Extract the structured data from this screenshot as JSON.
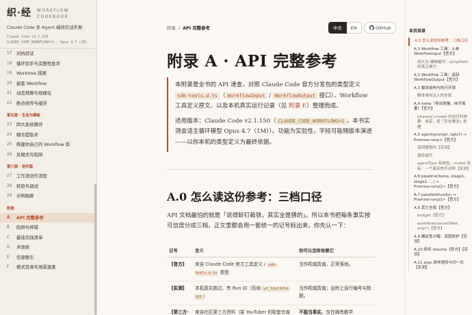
{
  "sidebar": {
    "brand_zh": "织·经",
    "brand_en_1": "WORKFLOW",
    "brand_en_2": "COOKBOOK",
    "subtitle": "Claude Code 多 Agent 编排实战手册",
    "version_1": "Claude Code v2.1.150 ·",
    "version_2": "CLAUDE_CODE_WORKFLOWS=1 · Opus 4.7 (1M)",
    "group1": [
      {
        "num": "17",
        "label": "对抗验证"
      },
      {
        "num": "18",
        "label": "循环到手与完整性批评"
      },
      {
        "num": "19",
        "label": "Worktree 隔离"
      },
      {
        "num": "20",
        "label": "嵌套 Workflow"
      },
      {
        "num": "21",
        "label": "动态预算与规模化"
      },
      {
        "num": "22",
        "label": "断点续传与缓存"
      }
    ],
    "section5": "第五部 · 生态与模板",
    "group5": [
      {
        "num": "23",
        "label": "四大系统横评"
      },
      {
        "num": "24",
        "label": "精华提取术"
      },
      {
        "num": "25",
        "label": "构建你自己的 Workflow 库"
      },
      {
        "num": "26",
        "label": "反模式与陷阱"
      }
    ],
    "section6": "第六部 · 创作篇",
    "group6": [
      {
        "num": "27",
        "label": "工作流创作流程"
      },
      {
        "num": "28",
        "label": "校验与调试"
      },
      {
        "num": "29",
        "label": "示例画廊"
      }
    ],
    "section_app": "附录",
    "appendix": [
      {
        "num": "A",
        "label": "API 完整参考",
        "active": true
      },
      {
        "num": "B",
        "label": "陷阱与排错"
      },
      {
        "num": "C",
        "label": "最佳实践清单"
      },
      {
        "num": "D",
        "label": "术语表"
      },
      {
        "num": "E",
        "label": "信源索引"
      },
      {
        "num": "F",
        "label": "模式目录与场景速查"
      }
    ]
  },
  "header": {
    "crumb_parent": "附录",
    "crumb_sep": "/",
    "crumb_current": "API 完整参考",
    "lang_zh": "中文",
    "lang_en": "EN",
    "github": "GitHub"
  },
  "content": {
    "title": "附录 A · API 完整参考",
    "callout_p1_a": "本附录是全书的 API 速查，对照 Claude Code 官方分发包的类型定义 ",
    "callout_p1_code1": "sdk-tools.d.ts",
    "callout_p1_b": "（",
    "callout_p1_code2": "WorkflowInput",
    "callout_p1_c": " / ",
    "callout_p1_code3": "WorkflowOutput",
    "callout_p1_d": " 接口）、Workflow 工具定义原文、以及本机真实运行记录（见 ",
    "callout_p1_link": "附录 E",
    "callout_p1_e": "）整理而成。",
    "callout_p2_a": "适用版本：Claude Code v2.1.150（",
    "callout_p2_code": "CLAUDE_CODE_WORKFLOWS=1",
    "callout_p2_b": "，本书实测会话主循环模型 Opus 4.7（1M））。功能为实验性，字段可能随版本演进——以你本机的类型定义为最终依据。",
    "h2": "A.0 怎么读这份参考：三档口径",
    "para": "API 文档最怕的就是「说得斩钉截铁，其实全是猜的」。所以本书把每条事实按可信度分成三档，正文里都会用一套统一的记号标出来，你先认一下：",
    "table_headers": [
      "记号",
      "含义",
      "你可以怎样依赖它"
    ],
    "row1_label": "【官方】",
    "row1_mean_a": "来自 Claude Code 官方工具定义 / ",
    "row1_mean_code": "sdk-tools.d.ts",
    "row1_mean_b": " 类型",
    "row1_rely": "当作权威真值，正常落地。",
    "row2_label": "【实测】",
    "row2_mean_a": "本机真实跑过、有 Run ID（形如 ",
    "row2_mean_code": "wf_59bf3654-183",
    "row2_mean_b": "）",
    "row2_rely": "当作权威真值；会附上运行编号与数据。",
    "row3_label": "【第三方·",
    "row3_mean": "来自社区第三方资料（某 YouTuber 的配套仓库",
    "row3_rely_a": "不能当事实",
    "row3_rely_b": "。仅在确有教学"
  },
  "toc": {
    "title": "本页目录",
    "items": [
      {
        "label": "A.0 怎么读这份参考：三档口径",
        "sub": false,
        "first": true
      },
      {
        "label": "A.1 Workflow 工具：入参 WorkflowInput【官方】",
        "sub": false
      },
      {
        "label": "持久化-编辑循环：scriptPath 的真正威力",
        "sub": true
      },
      {
        "label": "A.2 Workflow 工具：返回 WorkflowOutput【官方】",
        "sub": false
      },
      {
        "label": "A.3 脚本结构与执行环境",
        "sub": false
      },
      {
        "label": "脚本体内注入的全局",
        "sub": true
      },
      {
        "label": "A.4 meta（导出常量，纯字面量）【官方】",
        "sub": false
      },
      {
        "label": "phases[].model 的运行时效果：未定，按「安全做法」处理",
        "sub": true
      },
      {
        "label": "A.5 agent(prompt, opts?) → Promise<any>【官方】",
        "sub": false
      },
      {
        "label": "返回值契约【实测】",
        "sub": true
      },
      {
        "label": "透传细节",
        "sub": true
      },
      {
        "label": "agentType 有校验，model 没有：一个真实的不对称【实测】",
        "sub": true
      },
      {
        "label": "A.6 pipeline(items, stage1, stage2, ...) → Promise<any[]>【官方】",
        "sub": false
      },
      {
        "label": "A.7 parallel(thunks) → Promise<any[]>【官方】",
        "sub": false
      },
      {
        "label": "A.8 其它全局【官方】",
        "sub": false
      },
      {
        "label": "budget【官方】",
        "sub": true
      },
      {
        "label": "workflow(nameOrRef, args?)【官方】",
        "sub": true
      },
      {
        "label": "A.9 确定性沙箱：双层防护【实测】",
        "sub": false
      },
      {
        "label": "A.10 续传 resume【官方】【实测】",
        "sub": false
      },
      {
        "label": "A.11 args 原样透传与归一化【实测】",
        "sub": false
      }
    ]
  }
}
